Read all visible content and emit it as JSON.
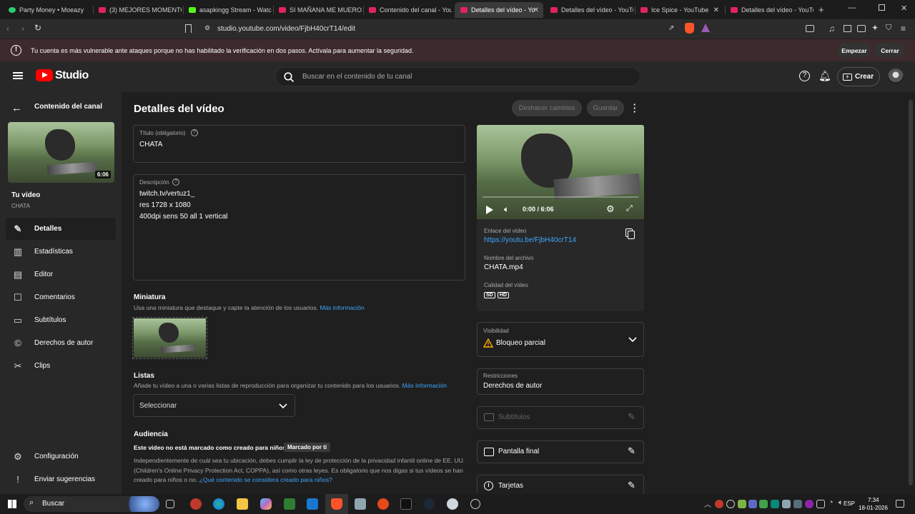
{
  "browser": {
    "tabs": [
      {
        "label": "Party Money • Moeazy",
        "fav": "#2ecc71"
      },
      {
        "label": "(3) MEJORES MOMENTOS",
        "fav": "#e0245e"
      },
      {
        "label": "asapkingg Stream - Watch",
        "fav": "#53fc18"
      },
      {
        "label": "SI MAÑANA ME MUERO -",
        "fav": "#e0245e"
      },
      {
        "label": "Contenido del canal - You",
        "fav": "#e0245e"
      },
      {
        "label": "Detalles del vídeo - Yo",
        "fav": "#e0245e"
      },
      {
        "label": "Detalles del vídeo - YouTu",
        "fav": "#e0245e"
      },
      {
        "label": "Ice Spice - YouTube",
        "fav": "#e0245e"
      },
      {
        "label": "Detalles del vídeo - YouTu",
        "fav": "#e0245e"
      }
    ],
    "url": "studio.youtube.com/video/FjbH40crT14/edit"
  },
  "banner": {
    "message": "Tu cuenta es más vulnerable ante ataques porque no has habilitado la verificación en dos pasos. Actívala para aumentar la seguridad.",
    "start_label": "Empezar",
    "close_label": "Cerrar"
  },
  "header": {
    "logo_text": "Studio",
    "search_placeholder": "Buscar en el contenido de tu canal",
    "create_label": "Crear"
  },
  "sidebar": {
    "back_label": "Contenido del canal",
    "thumb_duration": "6:06",
    "your_video_label": "Tu vídeo",
    "video_name": "CHATA",
    "items": [
      {
        "label": "Detalles",
        "icon": "pencil-icon"
      },
      {
        "label": "Estadísticas",
        "icon": "analytics-icon"
      },
      {
        "label": "Editor",
        "icon": "editor-icon"
      },
      {
        "label": "Comentarios",
        "icon": "comments-icon"
      },
      {
        "label": "Subtítulos",
        "icon": "subtitles-icon"
      },
      {
        "label": "Derechos de autor",
        "icon": "copyright-icon"
      },
      {
        "label": "Clips",
        "icon": "scissors-icon"
      }
    ],
    "settings_label": "Configuración",
    "feedback_label": "Enviar sugerencias"
  },
  "main": {
    "page_title": "Detalles del vídeo",
    "undo_label": "Deshacer cambios",
    "save_label": "Guardar",
    "title_field": {
      "label": "Título (obligatorio)",
      "value": "CHATA"
    },
    "description_field": {
      "label": "Descripción",
      "lines": [
        "twitch.tv/vertuz1_",
        "res 1728 x 1080",
        "400dpi sens 50 all 1 vertical"
      ]
    },
    "thumbnail": {
      "heading": "Miniatura",
      "help": "Usa una miniatura que destaque y capte la atención de los usuarios.",
      "more": "Más información"
    },
    "playlists": {
      "heading": "Listas",
      "help": "Añade tu vídeo a una o varias listas de reproducción para organizar tu contenido para los usuarios.",
      "more": "Más información",
      "select_label": "Seleccionar"
    },
    "audience": {
      "heading": "Audiencia",
      "status": "Este vídeo no está marcado como creado para niños",
      "badge": "Marcado por ti",
      "body": "Independientemente de cuál sea tu ubicación, debes cumplir la ley de protección de la privacidad infantil online de EE. UU. (Children's Online Privacy Protection Act, COPPA), así como otras leyes. Es obligatorio que nos digas si tus vídeos se han creado para niños o no.",
      "link": "¿Qué contenido se considera creado para niños?"
    }
  },
  "right_panel": {
    "player_time": "0:00 / 6:06",
    "player_progress": 0,
    "video_link_label": "Enlace del vídeo",
    "video_link": "https://youtu.be/FjbH40crT14",
    "filename_label": "Nombre del archivo",
    "filename": "CHATA.mp4",
    "quality_label": "Calidad del vídeo",
    "quality_badges": [
      "SD",
      "HD"
    ],
    "visibility_label": "Visibilidad",
    "visibility_value": "Bloqueo parcial",
    "restrictions_label": "Restricciones",
    "restrictions_value": "Derechos de autor",
    "subtitles_label": "Subtítulos",
    "end_screen_label": "Pantalla final",
    "cards_label": "Tarjetas"
  },
  "taskbar": {
    "search_label": "Buscar",
    "lang": "ESP",
    "time": "7:34",
    "date": "18-01-2026"
  },
  "colors": {
    "accent_link": "#3ea6ff",
    "warning": "#f9ab00",
    "banner_bg": "#3d2a2c",
    "youtube_red": "#ff0000"
  }
}
